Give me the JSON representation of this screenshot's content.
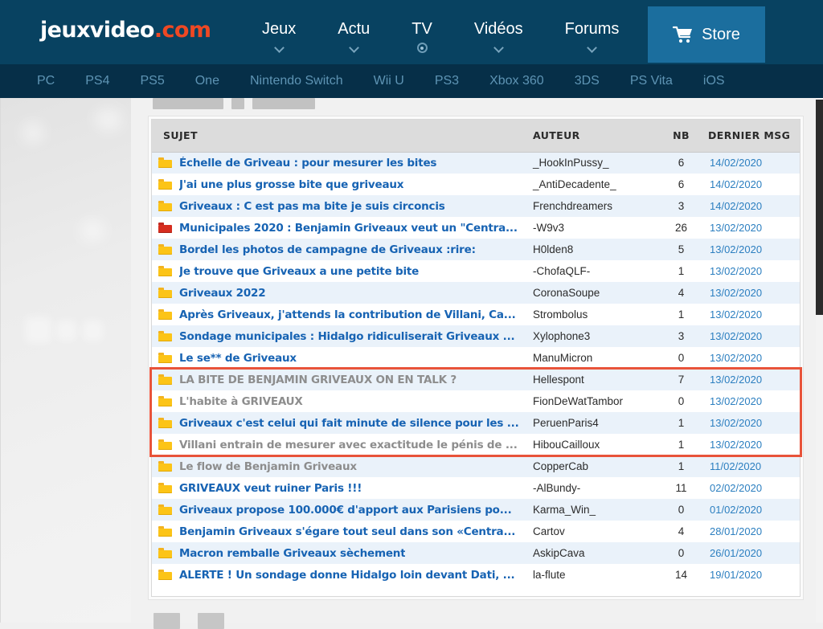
{
  "site": {
    "logo_main": "jeuxvideo",
    "logo_suffix": ".com",
    "accent_orange": "#ef4823",
    "header_blue": "#084261",
    "subnav_blue": "#062f48",
    "store_blue": "#1b6e9e",
    "link_blue": "#1763b3",
    "visited_gray": "#8d8d8d",
    "highlight_red": "#e8533a"
  },
  "mainnav": {
    "items": [
      {
        "label": "Jeux",
        "indicator": "chevron-down-icon"
      },
      {
        "label": "Actu",
        "indicator": "chevron-down-icon"
      },
      {
        "label": "TV",
        "indicator": "live-dot-icon"
      },
      {
        "label": "Vidéos",
        "indicator": "chevron-down-icon"
      },
      {
        "label": "Forums",
        "indicator": "chevron-down-icon"
      }
    ],
    "store": {
      "label": "Store",
      "icon": "shopping-cart-icon"
    }
  },
  "subnav": {
    "items": [
      {
        "label": "PC"
      },
      {
        "label": "PS4"
      },
      {
        "label": "PS5"
      },
      {
        "label": "One"
      },
      {
        "label": "Nintendo Switch"
      },
      {
        "label": "Wii U"
      },
      {
        "label": "PS3"
      },
      {
        "label": "Xbox 360"
      },
      {
        "label": "3DS"
      },
      {
        "label": "PS Vita"
      },
      {
        "label": "iOS"
      }
    ]
  },
  "table": {
    "headers": {
      "sujet": "SUJET",
      "auteur": "AUTEUR",
      "nb": "NB",
      "dernier_msg": "DERNIER MSG"
    },
    "rows": [
      {
        "icon": "folder-icon-yellow",
        "title": "Échelle de Griveau : pour mesurer les bites",
        "visited": false,
        "author": "_HookInPussy_",
        "nb": "6",
        "date": "14/02/2020"
      },
      {
        "icon": "folder-icon-yellow",
        "title": "J'ai une plus grosse bite que griveaux",
        "visited": false,
        "author": "_AntiDecadente_",
        "nb": "6",
        "date": "14/02/2020"
      },
      {
        "icon": "folder-icon-yellow",
        "title": "Griveaux : C est pas ma bite je suis circoncis",
        "visited": false,
        "author": "Frenchdreamers",
        "nb": "3",
        "date": "14/02/2020"
      },
      {
        "icon": "folder-icon-red",
        "title": "Municipales 2020 : Benjamin Griveaux veut un \"Centra...",
        "visited": false,
        "author": "-W9v3",
        "nb": "26",
        "date": "13/02/2020"
      },
      {
        "icon": "folder-icon-yellow",
        "title": "Bordel les photos de campagne de Griveaux :rire:",
        "visited": false,
        "author": "H0lden8",
        "nb": "5",
        "date": "13/02/2020"
      },
      {
        "icon": "folder-icon-yellow",
        "title": "Je trouve que Griveaux a une petite bite",
        "visited": false,
        "author": "-ChofaQLF-",
        "nb": "1",
        "date": "13/02/2020"
      },
      {
        "icon": "folder-icon-yellow",
        "title": "Griveaux 2022",
        "visited": false,
        "author": "CoronaSoupe",
        "nb": "4",
        "date": "13/02/2020"
      },
      {
        "icon": "folder-icon-yellow",
        "title": "Après Griveaux, j'attends la contribution de Villani, Ca...",
        "visited": false,
        "author": "Strombolus",
        "nb": "1",
        "date": "13/02/2020"
      },
      {
        "icon": "folder-icon-yellow",
        "title": "Sondage municipales : Hidalgo ridiculiserait Griveaux ...",
        "visited": false,
        "author": "Xylophone3",
        "nb": "3",
        "date": "13/02/2020"
      },
      {
        "icon": "folder-icon-yellow",
        "title": "Le se** de Griveaux",
        "visited": false,
        "author": "ManuMicron",
        "nb": "0",
        "date": "13/02/2020"
      },
      {
        "icon": "folder-icon-yellow",
        "title": "LA BITE DE BENJAMIN GRIVEAUX ON EN TALK ?",
        "visited": true,
        "author": "Hellespont",
        "nb": "7",
        "date": "13/02/2020"
      },
      {
        "icon": "folder-icon-yellow",
        "title": "L'habite à GRIVEAUX",
        "visited": true,
        "author": "FionDeWatTambor",
        "nb": "0",
        "date": "13/02/2020"
      },
      {
        "icon": "folder-icon-yellow",
        "title": "Griveaux c'est celui qui fait minute de silence pour les ...",
        "visited": false,
        "author": "PeruenParis4",
        "nb": "1",
        "date": "13/02/2020"
      },
      {
        "icon": "folder-icon-yellow",
        "title": "Villani entrain de mesurer avec exactitude le pénis de ...",
        "visited": true,
        "author": "HibouCailloux",
        "nb": "1",
        "date": "13/02/2020"
      },
      {
        "icon": "folder-icon-yellow",
        "title": "Le flow de Benjamin Griveaux",
        "visited": true,
        "author": "CopperCab",
        "nb": "1",
        "date": "11/02/2020"
      },
      {
        "icon": "folder-icon-yellow",
        "title": "GRIVEAUX veut ruiner Paris !!!",
        "visited": false,
        "author": "-AlBundy-",
        "nb": "11",
        "date": "02/02/2020"
      },
      {
        "icon": "folder-icon-yellow",
        "title": "Griveaux propose 100.000€ d'apport aux Parisiens po...",
        "visited": false,
        "author": "Karma_Win_",
        "nb": "0",
        "date": "01/02/2020"
      },
      {
        "icon": "folder-icon-yellow",
        "title": "Benjamin Griveaux s'égare tout seul dans son «Centra...",
        "visited": false,
        "author": "Cartov",
        "nb": "4",
        "date": "28/01/2020"
      },
      {
        "icon": "folder-icon-yellow",
        "title": "Macron remballe Griveaux sèchement",
        "visited": false,
        "author": "AskipCava",
        "nb": "0",
        "date": "26/01/2020"
      },
      {
        "icon": "folder-icon-yellow",
        "title": "ALERTE ! Un sondage donne Hidalgo loin devant Dati, ...",
        "visited": false,
        "author": "la-flute",
        "nb": "14",
        "date": "19/01/2020"
      }
    ]
  },
  "annotation": {
    "highlight_rows": [
      11,
      12,
      13,
      14
    ],
    "color": "#e8533a"
  }
}
